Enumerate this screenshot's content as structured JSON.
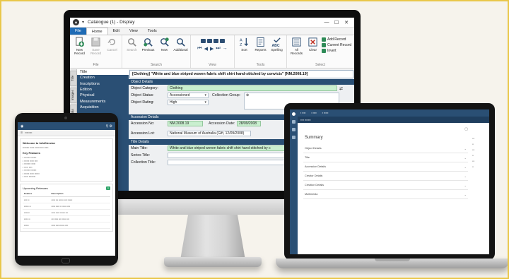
{
  "desktop": {
    "window_title": "Catalogue (1) - Display",
    "quick_access": "▾",
    "controls": [
      "—",
      "☐",
      "✕"
    ],
    "menu": {
      "file": "File",
      "home": "Home",
      "edit": "Edit",
      "view": "View",
      "tools": "Tools"
    },
    "ribbon": {
      "file_group": {
        "label": "File",
        "buttons": [
          "New Record",
          "Save Record",
          "Cancel"
        ]
      },
      "search_group": {
        "label": "Search",
        "buttons": [
          "Search",
          "Previous",
          "New",
          "Additional"
        ]
      },
      "view_group": {
        "label": "View"
      },
      "tools_group": {
        "label": "Tools",
        "buttons": [
          "Sort",
          "Reports",
          "Spelling"
        ]
      },
      "select_group": {
        "label": "Select",
        "buttons": [
          "All Records",
          "Clear"
        ],
        "list": [
          "Add Record",
          "Current Record",
          "Invert"
        ]
      }
    },
    "vertical_tabs": [
      "Title",
      "Images",
      "Multimedia"
    ],
    "nav_items": [
      "Title",
      "Creation",
      "Inscriptions",
      "Edition",
      "Physical",
      "Measurements",
      "Acquisition"
    ],
    "record_title": "[Clothing] \"White and blue striped woven fabric shift shirt hand-stitched by convicts\" [NM.2008.19]",
    "sections": {
      "object_details": "Object Details",
      "accession_details": "Accession Details",
      "title_details": "Title Details"
    },
    "fields": {
      "object_category_label": "Object Category:",
      "object_category": "Clothing",
      "object_status_label": "Object Status:",
      "object_status": "Accessioned",
      "collection_group_label": "Collection Group:",
      "object_rating_label": "Object Rating:",
      "object_rating": "High",
      "accession_no_label": "Accession No:",
      "accession_no": "NM.2008.19",
      "accession_date_label": "Accession Date:",
      "accession_date": "28/09/2008",
      "accession_lot_label": "Accession Lot:",
      "accession_lot": "National Museum of Australia (Gift, 12/09/2008)",
      "main_title_label": "Main Title:",
      "main_title": "White and blue striped woven fabric shift shirt hand-stitched by c",
      "series_title_label": "Series Title:",
      "collection_title_label": "Collection Title:"
    }
  },
  "tablet": {
    "welcome_heading": "Welcome to InfoDirector",
    "key_features": "Key Features",
    "upcoming": "Upcoming Releases",
    "table_headers": [
      "Feature",
      "Description"
    ]
  },
  "laptop": {
    "summary": "Summary",
    "rows": [
      "Object Details",
      "Title",
      "Accession Details",
      "Creator Details",
      "Creation Details",
      "Multimedia"
    ]
  }
}
